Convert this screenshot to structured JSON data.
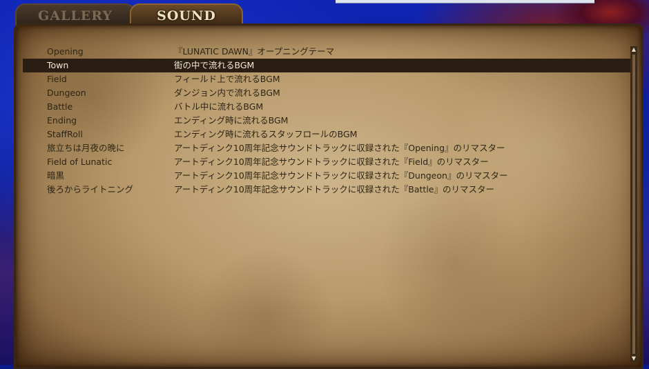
{
  "tabs": {
    "gallery": "GALLERY",
    "sound": "SOUND"
  },
  "sound_list": {
    "selected_index": 1,
    "tracks": [
      {
        "name": "Opening",
        "description": "『LUNATIC DAWN』オープニングテーマ"
      },
      {
        "name": "Town",
        "description": "街の中で流れるBGM"
      },
      {
        "name": "Field",
        "description": "フィールド上で流れるBGM"
      },
      {
        "name": "Dungeon",
        "description": "ダンジョン内で流れるBGM"
      },
      {
        "name": "Battle",
        "description": "バトル中に流れるBGM"
      },
      {
        "name": "Ending",
        "description": "エンディング時に流れるBGM"
      },
      {
        "name": "StaffRoll",
        "description": "エンディング時に流れるスタッフロールのBGM"
      },
      {
        "name": "旅立ちは月夜の晩に",
        "description": "アートディンク10周年記念サウンドトラックに収録された『Opening』のリマスター"
      },
      {
        "name": "Field of Lunatic",
        "description": "アートディンク10周年記念サウンドトラックに収録された『Field』のリマスター"
      },
      {
        "name": "暗黒",
        "description": "アートディンク10周年記念サウンドトラックに収録された『Dungeon』のリマスター"
      },
      {
        "name": "後ろからライトニング",
        "description": "アートディンク10周年記念サウンドトラックに収録された『Battle』のリマスター"
      }
    ]
  },
  "scrollbar": {
    "up_icon": "▲",
    "down_icon": "▼"
  }
}
